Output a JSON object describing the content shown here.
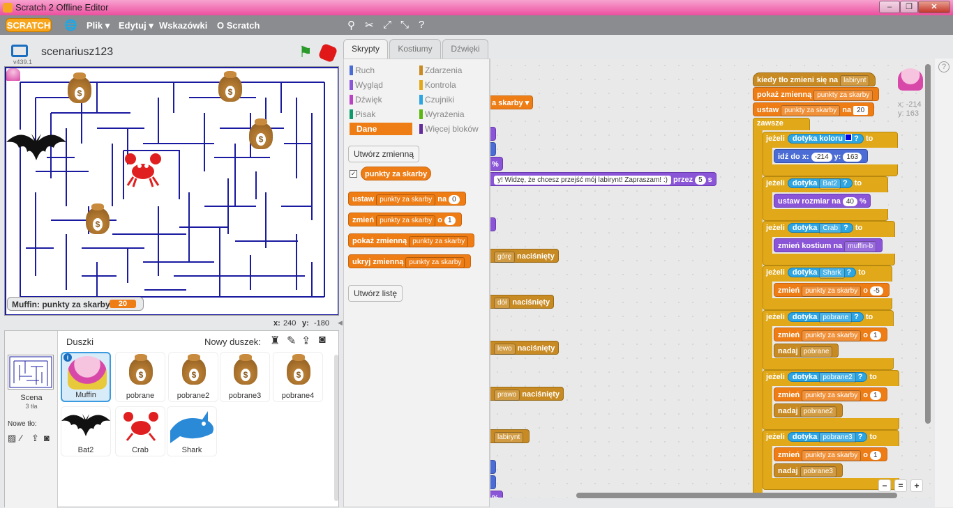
{
  "window": {
    "title": "Scratch 2 Offline Editor"
  },
  "menubar": {
    "logo": "SCRATCH",
    "file": "Plik ▾",
    "edit": "Edytuj ▾",
    "tips": "Wskazówki",
    "about": "O Scratch"
  },
  "stage": {
    "project_name": "scenariusz123",
    "version": "v439.1",
    "coord_x_label": "x:",
    "coord_x": "240",
    "coord_y_label": "y:",
    "coord_y": "-180"
  },
  "monitor": {
    "label": "Muffin: punkty za skarby",
    "value": "20"
  },
  "sprites_panel": {
    "title": "Duszki",
    "new_sprite": "Nowy duszek:",
    "scene_label": "Scena",
    "scene_count": "3 tła",
    "new_backdrop": "Nowe tło:",
    "sprites": [
      "Muffin",
      "pobrane",
      "pobrane2",
      "pobrane3",
      "pobrane4",
      "Bat2",
      "Crab",
      "Shark"
    ]
  },
  "tabs": {
    "scripts": "Skrypty",
    "costumes": "Kostiumy",
    "sounds": "Dźwięki"
  },
  "categories": {
    "motion": "Ruch",
    "looks": "Wygląd",
    "sound": "Dźwięk",
    "pen": "Pisak",
    "data": "Dane",
    "events": "Zdarzenia",
    "control": "Kontrola",
    "sensing": "Czujniki",
    "operators": "Wyrażenia",
    "more": "Więcej bloków"
  },
  "palette": {
    "make_var": "Utwórz zmienną",
    "var_name": "punkty za skarby",
    "set_label": "ustaw",
    "set_to": "na",
    "set_val": "0",
    "change_label": "zmień",
    "change_by": "o",
    "change_val": "1",
    "show_label": "pokaż zmienną",
    "hide_label": "ukryj zmienną",
    "make_list": "Utwórz listę"
  },
  "script": {
    "hat": "kiedy tło zmieni się na",
    "hat_val": "labirynt",
    "show": "pokaż zmienną",
    "var": "punkty za skarby",
    "set": "ustaw",
    "set_na": "na",
    "set_val": "20",
    "forever": "zawsze",
    "if": "jeżeli",
    "then": "to",
    "touch_color": "dotyka koloru",
    "q": "?",
    "goto": "idź do x:",
    "goto_x": "-214",
    "goto_y_lbl": "y:",
    "goto_y": "163",
    "touch": "dotyka",
    "bat": "Bat2",
    "scale": "ustaw rozmiar na",
    "scale_val": "40",
    "pct": "%",
    "crab": "Crab",
    "costume": "zmień kostium na",
    "costume_val": "muffin-b",
    "shark": "Shark",
    "change": "zmień",
    "o": "o",
    "minus5": "-5",
    "pobrane": "pobrane",
    "one": "1",
    "broadcast": "nadaj",
    "pobrane2": "pobrane2",
    "pobrane3": "pobrane3",
    "left_frag1": "a skarby",
    "left_frag2": "%",
    "say_text": "y! Widzę, że chcesz przejść mój labirynt! Zapraszam! :)",
    "say_for": "przez",
    "say_num": "5",
    "say_s": "s",
    "key_up": "górę",
    "key_down": "dół",
    "key_left": "lewo",
    "key_right": "prawo",
    "key_pressed": "naciśnięty",
    "backdrop": "labirynt",
    "pct2": "%",
    "sprite_x": "x: -214",
    "sprite_y": "y: 163"
  },
  "colors": {
    "accent": "#ee7d16",
    "titlebar": "#ec4e9f",
    "menubar": "#8a8c8f",
    "maze": "#1a1aa0"
  }
}
